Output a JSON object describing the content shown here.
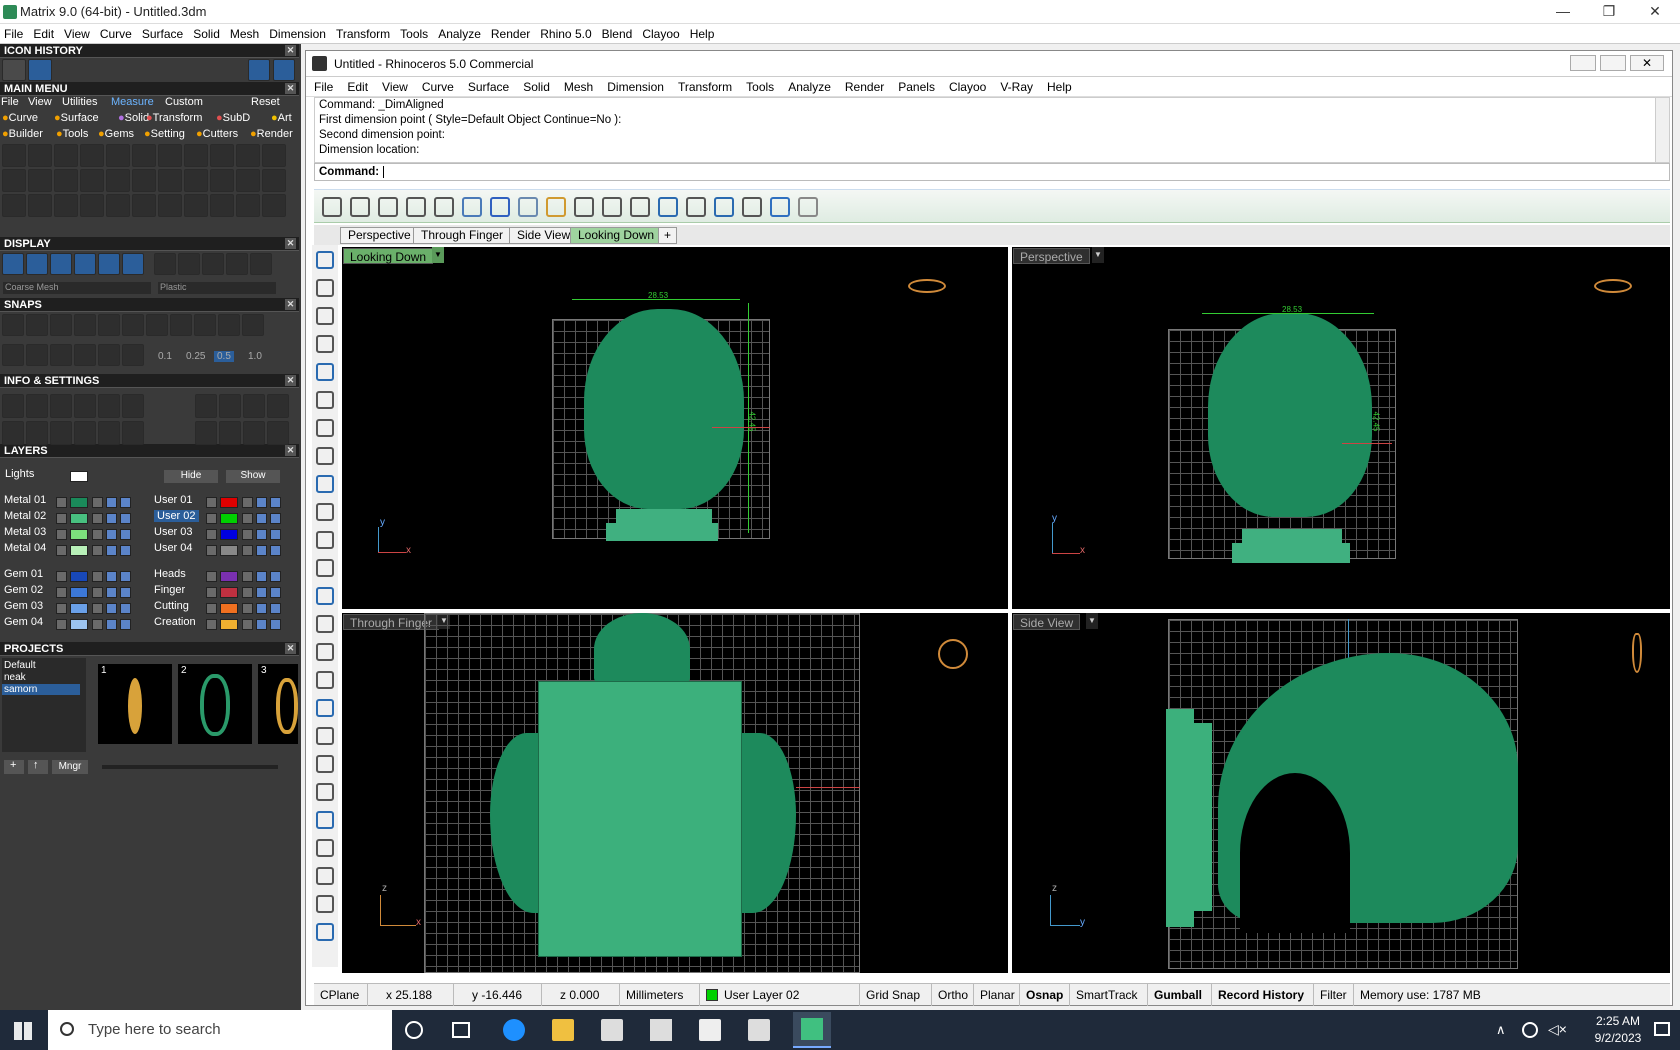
{
  "outer": {
    "title": "Matrix 9.0 (64-bit) - Untitled.3dm",
    "menu": [
      "File",
      "Edit",
      "View",
      "Curve",
      "Surface",
      "Solid",
      "Mesh",
      "Dimension",
      "Transform",
      "Tools",
      "Analyze",
      "Render",
      "Rhino 5.0",
      "Blend",
      "Clayoo",
      "Help"
    ]
  },
  "left": {
    "icon_history": "ICON HISTORY",
    "main_menu": "MAIN MENU",
    "mm_row1": [
      "File",
      "View",
      "Utilities",
      "Measure",
      "Custom",
      "Reset"
    ],
    "mm_row2": [
      "Curve",
      "Surface",
      "Solid",
      "Transform",
      "SubD",
      "Art"
    ],
    "mm_row3": [
      "Builder",
      "Tools",
      "Gems",
      "Setting",
      "Cutters",
      "Render"
    ],
    "display": "DISPLAY",
    "display_mesh": "Coarse Mesh",
    "display_mat": "Plastic",
    "snaps": "SNAPS",
    "snap_values": [
      "0.1",
      "0.25",
      "0.5",
      "1.0"
    ],
    "info": "INFO & SETTINGS",
    "layers": "LAYERS",
    "lights": "Lights",
    "hide": "Hide",
    "show": "Show",
    "layers_left": [
      {
        "name": "Metal 01",
        "color": "#1a8a5a"
      },
      {
        "name": "Metal 02",
        "color": "#48c080"
      },
      {
        "name": "Metal 03",
        "color": "#7ce07c"
      },
      {
        "name": "Metal 04",
        "color": "#b8f0b8"
      },
      {
        "name": "Gem 01",
        "color": "#1848b8"
      },
      {
        "name": "Gem 02",
        "color": "#3c78d8"
      },
      {
        "name": "Gem 03",
        "color": "#6aa0e8"
      },
      {
        "name": "Gem 04",
        "color": "#9cc4f0"
      }
    ],
    "layers_right": [
      {
        "name": "User 01",
        "color": "#e00000"
      },
      {
        "name": "User 02",
        "color": "#00d000"
      },
      {
        "name": "User 03",
        "color": "#0000e0"
      },
      {
        "name": "User 04",
        "color": "#888888"
      },
      {
        "name": "Heads",
        "color": "#7a30b0"
      },
      {
        "name": "Finger",
        "color": "#c03040"
      },
      {
        "name": "Cutting",
        "color": "#f07020"
      },
      {
        "name": "Creation",
        "color": "#f0b030"
      }
    ],
    "projects": "PROJECTS",
    "project_list": [
      "Default",
      "neak",
      "samorn"
    ],
    "thumbs": [
      "1",
      "2",
      "3"
    ],
    "mngr": "Mngr"
  },
  "rhino": {
    "title": "Untitled - Rhinoceros 5.0 Commercial",
    "menu": [
      "File",
      "Edit",
      "View",
      "Curve",
      "Surface",
      "Solid",
      "Mesh",
      "Dimension",
      "Transform",
      "Tools",
      "Analyze",
      "Render",
      "Panels",
      "Clayoo",
      "V-Ray",
      "Help"
    ],
    "cmd_history": [
      "Command: _DimAligned",
      "First dimension point ( Style=Default  Object  Continue=No ):",
      "Second dimension point:",
      "Dimension location:"
    ],
    "cmd_prompt": "Command:",
    "tabs": [
      "Perspective",
      "Through Finger",
      "Side View",
      "Looking Down"
    ],
    "viewports": {
      "top_left": "Looking Down",
      "top_right": "Perspective",
      "bottom_left": "Through Finger",
      "bottom_right": "Side View"
    },
    "dims": {
      "width": "28.53",
      "height": "42.45"
    },
    "status": {
      "cplane": "CPlane",
      "x": "x 25.188",
      "y": "y -16.446",
      "z": "z 0.000",
      "units": "Millimeters",
      "layer": "User Layer 02",
      "grid": "Grid Snap",
      "ortho": "Ortho",
      "planar": "Planar",
      "osnap": "Osnap",
      "smart": "SmartTrack",
      "gumball": "Gumball",
      "history": "Record History",
      "filter": "Filter",
      "memory": "Memory use: 1787 MB"
    }
  },
  "taskbar": {
    "search": "Type here to search",
    "time": "2:25 AM",
    "date": "9/2/2023"
  }
}
